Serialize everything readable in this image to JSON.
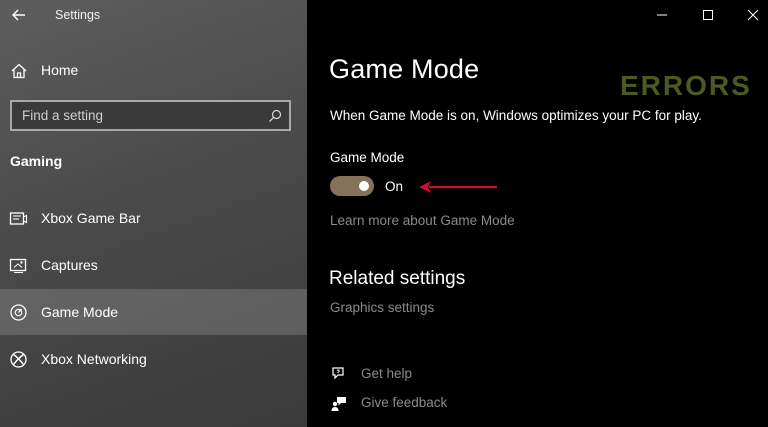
{
  "window": {
    "title": "Settings"
  },
  "sidebar": {
    "home_label": "Home",
    "search_placeholder": "Find a setting",
    "section_title": "Gaming",
    "items": [
      {
        "label": "Xbox Game Bar",
        "icon": "xbox-game-bar-icon"
      },
      {
        "label": "Captures",
        "icon": "captures-icon"
      },
      {
        "label": "Game Mode",
        "icon": "game-mode-icon",
        "selected": true
      },
      {
        "label": "Xbox Networking",
        "icon": "xbox-icon"
      }
    ]
  },
  "main": {
    "title": "Game Mode",
    "watermark": "ERRORS",
    "description": "When Game Mode is on, Windows optimizes your PC for play.",
    "toggle_label": "Game Mode",
    "toggle_state": "On",
    "learn_more": "Learn more about Game Mode",
    "related_title": "Related settings",
    "graphics_link": "Graphics settings",
    "get_help": "Get help",
    "give_feedback": "Give feedback"
  },
  "colors": {
    "toggle_on": "#847259",
    "arrow": "#c8102e",
    "link": "#8a8a8a",
    "watermark": "#4c5a22"
  }
}
